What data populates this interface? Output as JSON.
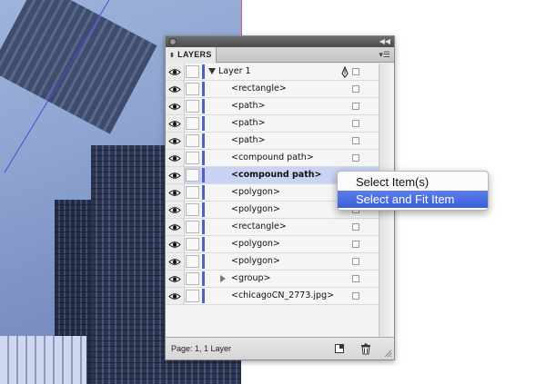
{
  "panel": {
    "tab_label": "LAYERS",
    "footer_status": "Page: 1, 1 Layer"
  },
  "layers": {
    "top_layer": "Layer 1",
    "items": [
      "<rectangle>",
      "<path>",
      "<path>",
      "<path>",
      "<compound path>",
      "<compound path>",
      "<polygon>",
      "<polygon>",
      "<rectangle>",
      "<polygon>",
      "<polygon>",
      "<group>",
      "<chicagoCN_2773.jpg>"
    ],
    "selected_index": 5,
    "layer_color": "#4d62c9"
  },
  "context_menu": {
    "items": [
      "Select Item(s)",
      "Select and Fit Item"
    ],
    "highlighted_index": 1
  },
  "icons": {
    "visibility": "eye-icon",
    "pen": "pen-icon",
    "new_layer": "new-layer-icon",
    "delete": "trash-icon"
  }
}
